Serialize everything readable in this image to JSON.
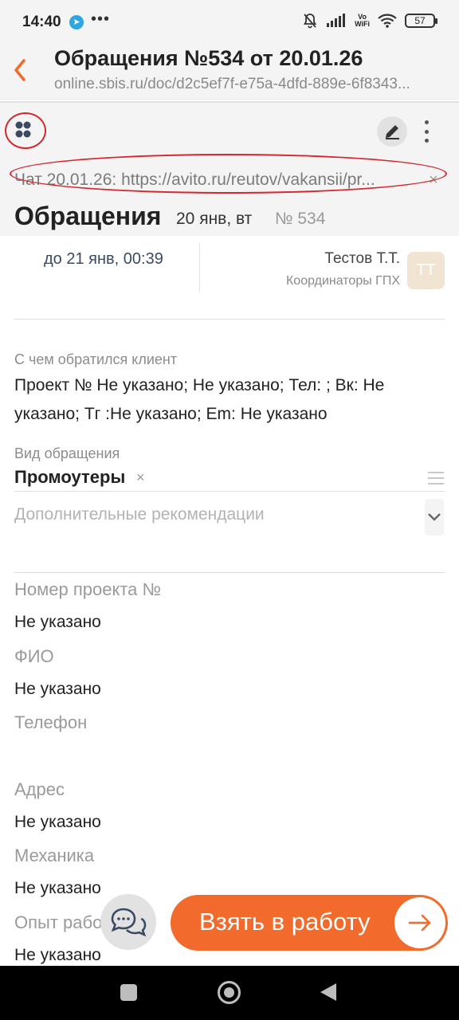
{
  "status_bar": {
    "time": "14:40",
    "telegram_icon": "telegram-icon",
    "more_indicator": "•••",
    "vo_wifi_top": "Vo",
    "vo_wifi_bottom": "WiFi",
    "battery": "57"
  },
  "header": {
    "title": "Обращения №534 от 20.01.26",
    "url": "online.sbis.ru/doc/d2c5ef7f-e75a-4dfd-889e-6f8343..."
  },
  "toolbar": {
    "chat_link": "Чат 20.01.26: https://avito.ru/reutov/vakansii/pr...",
    "chat_close": "×"
  },
  "document": {
    "title": "Обращения",
    "date": "20 янв, вт",
    "number": "№ 534",
    "deadline": "до 21 янв, 00:39",
    "assignee_name": "Тестов Т.Т.",
    "assignee_group": "Координаторы ГПХ",
    "assignee_initials": "ТТ"
  },
  "fields": {
    "client_request_label": "С чем обратился клиент",
    "client_request_line1": "Проект № Не указано; Не указано; Тел: ; Вк: Не",
    "client_request_line2": "указано; Тг :Не указано; Em: Не указано",
    "type_label": "Вид обращения",
    "type_value": "Промоутеры",
    "type_remove": "×",
    "recommendations_placeholder": "Дополнительные рекомендации",
    "project_number_label": "Номер проекта №",
    "project_number_value": "Не указано",
    "fio_label": "ФИО",
    "fio_value": "Не указано",
    "phone_label": "Телефон",
    "address_label": "Адрес",
    "address_value": "Не указано",
    "mechanics_label": "Механика",
    "mechanics_value": "Не указано",
    "experience_label": "Опыт работы",
    "experience_value": "Не указано"
  },
  "actions": {
    "take_to_work": "Взять в работу"
  },
  "colors": {
    "accent": "#f26b2c",
    "annotation_red": "#d6262e",
    "header_bg": "#f4f4f4"
  }
}
